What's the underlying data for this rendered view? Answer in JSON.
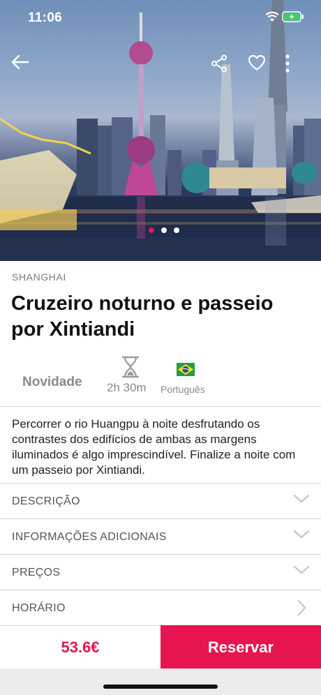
{
  "status_bar": {
    "time": "11:06"
  },
  "hero": {
    "description": "Shanghai skyline at night",
    "carousel_dot_count": 3,
    "active_dot_index": 0,
    "icons": [
      "back-arrow-icon",
      "share-icon",
      "heart-icon",
      "more-vertical-icon"
    ]
  },
  "tour": {
    "city": "SHANGHAI",
    "title": "Cruzeiro noturno e passeio por Xintiandi",
    "badge": "Novidade",
    "duration": "2h 30m",
    "language": "Português",
    "summary": "Percorrer o rio Huangpu à noite desfrutando os contrastes dos edifícios de ambas as margens iluminados é algo imprescindível. Finalize a noite com um passeio por Xintiandi."
  },
  "sections": [
    {
      "label": "DESCRIÇÃO",
      "icon": "chevron-down-icon"
    },
    {
      "label": "INFORMAÇÕES ADICIONAIS",
      "icon": "chevron-down-icon"
    },
    {
      "label": "PREÇOS",
      "icon": "chevron-down-icon"
    },
    {
      "label": "HORÁRIO",
      "icon": "chevron-right-icon"
    }
  ],
  "footer": {
    "price": "53.6€",
    "reserve_label": "Reservar"
  },
  "colors": {
    "accent": "#e6154f",
    "muted_text": "#8a8a8a",
    "divider": "#d4d4d4"
  }
}
